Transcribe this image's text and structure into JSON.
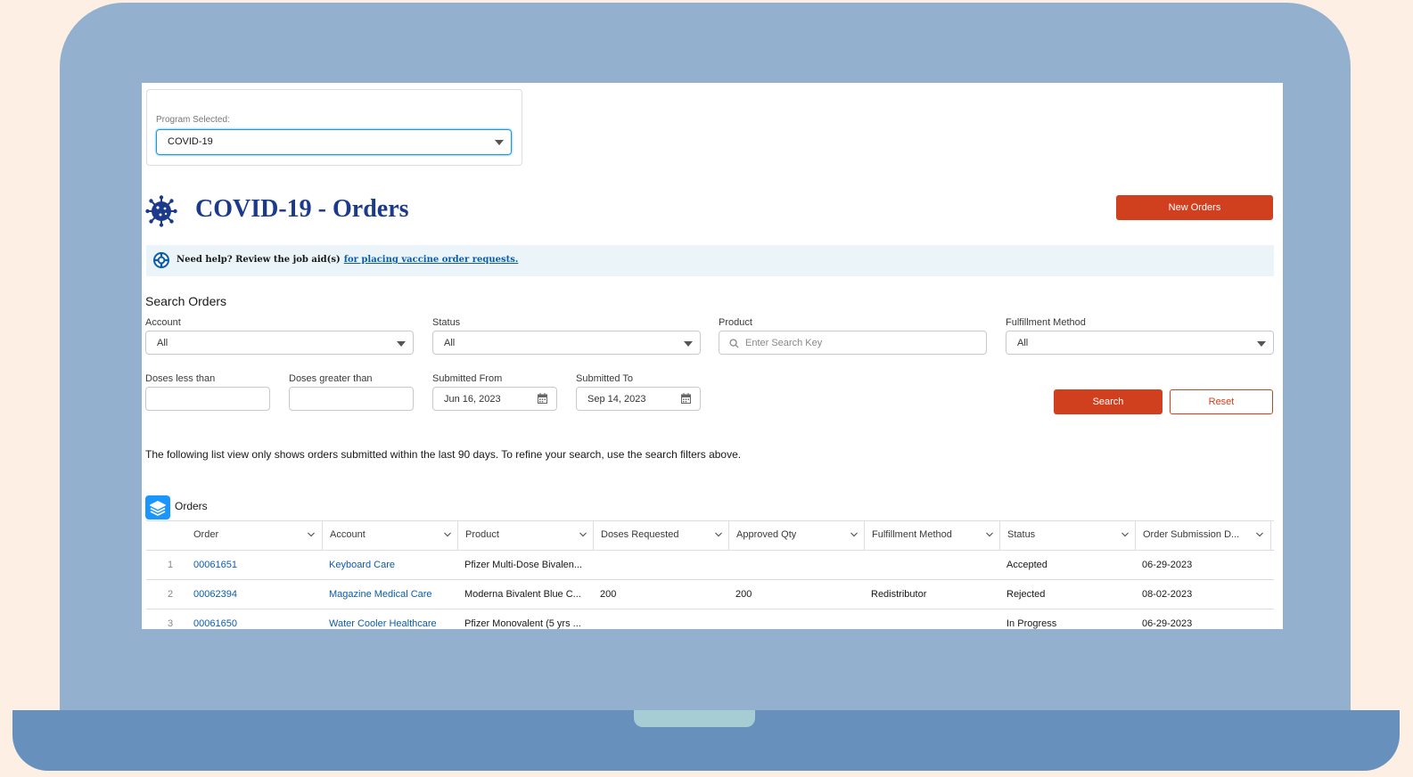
{
  "program": {
    "label": "Program Selected:",
    "value": "COVID-19"
  },
  "page": {
    "title": "COVID-19 - Orders",
    "new_orders_label": "New Orders"
  },
  "help": {
    "text": "Need help? Review the job aid(s)",
    "link": "for placing vaccine order requests."
  },
  "search": {
    "heading": "Search Orders",
    "account": {
      "label": "Account",
      "value": "All"
    },
    "status": {
      "label": "Status",
      "value": "All"
    },
    "product": {
      "label": "Product",
      "placeholder": "Enter Search Key"
    },
    "fulfillment": {
      "label": "Fulfillment Method",
      "value": "All"
    },
    "doses_less": {
      "label": "Doses less than",
      "value": ""
    },
    "doses_greater": {
      "label": "Doses greater than",
      "value": ""
    },
    "from": {
      "label": "Submitted From",
      "value": "Jun 16, 2023"
    },
    "to": {
      "label": "Submitted To",
      "value": "Sep 14, 2023"
    },
    "search_label": "Search",
    "reset_label": "Reset"
  },
  "notice": "The following list view only shows orders submitted within the last 90 days. To refine your search, use the search filters above.",
  "orders": {
    "title": "Orders",
    "columns": [
      "Order",
      "Account",
      "Product",
      "Doses Requested",
      "Approved Qty",
      "Fulfillment Method",
      "Status",
      "Order Submission D..."
    ],
    "rows": [
      {
        "num": "1",
        "order": "00061651",
        "account": "Keyboard Care",
        "product": "Pfizer Multi-Dose Bivalen...",
        "doses": "",
        "approved": "",
        "fulfillment": "",
        "status": "Accepted",
        "date": "06-29-2023"
      },
      {
        "num": "2",
        "order": "00062394",
        "account": "Magazine Medical Care",
        "product": "Moderna Bivalent Blue C...",
        "doses": "200",
        "approved": "200",
        "fulfillment": "Redistributor",
        "status": "Rejected",
        "date": "08-02-2023"
      },
      {
        "num": "3",
        "order": "00061650",
        "account": "Water Cooler Healthcare",
        "product": "Pfizer Monovalent (5 yrs ...",
        "doses": "",
        "approved": "",
        "fulfillment": "",
        "status": "In Progress",
        "date": "06-29-2023"
      }
    ]
  },
  "colors": {
    "accent": "#d0401e",
    "title": "#1b3a8c",
    "link": "#0b5cab",
    "orders_icon": "#1b96ff"
  }
}
